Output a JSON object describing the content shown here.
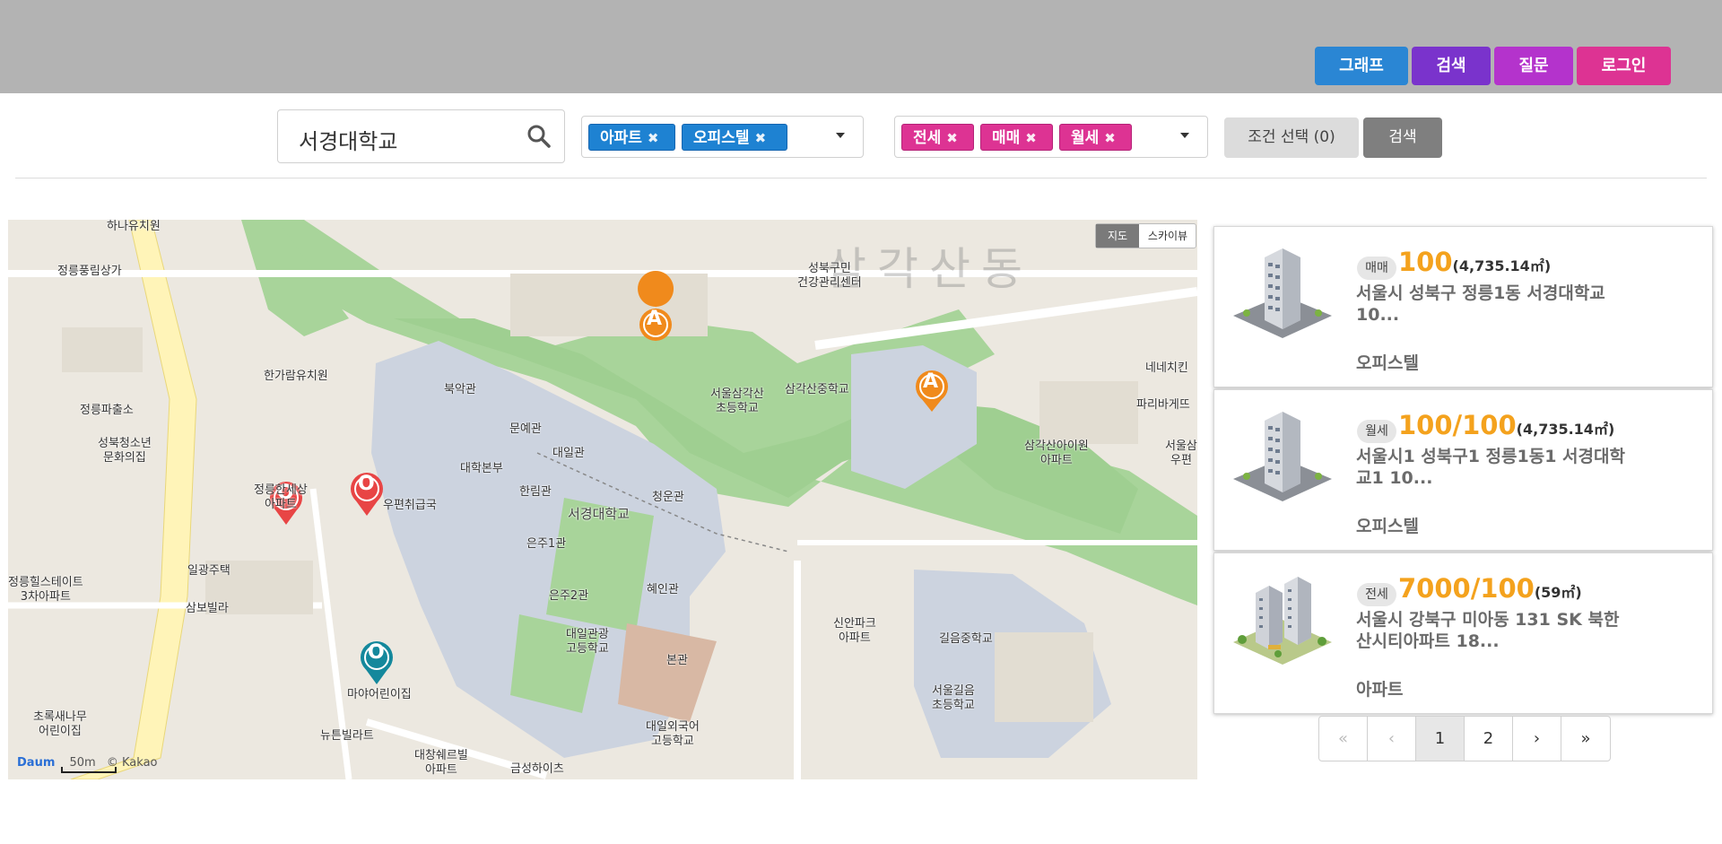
{
  "header": {
    "buttons": {
      "graph": "그래프",
      "search": "검색",
      "question": "질문",
      "login": "로그인"
    }
  },
  "search": {
    "value": "서경대학교",
    "icon": "search-icon"
  },
  "filters": {
    "type_chips": [
      "아파트",
      "오피스텔"
    ],
    "deal_chips": [
      "전세",
      "매매",
      "월세"
    ],
    "chip_remove_glyph": "✖",
    "condition_button": "조건 선택 (0)",
    "search_button": "검색"
  },
  "map": {
    "type_toggle": {
      "map": "지도",
      "skyview": "스카이뷰"
    },
    "dong_label": "삼각산동",
    "scale": "50m",
    "copyright": "© Kakao",
    "logo": "Daum",
    "labels": {
      "jeongneung_plaza": "정릉풍림상가",
      "police": "정릉파출소",
      "youth_center": "성북청소년\n문화의집",
      "hangaram": "한가람유치원",
      "bugak": "북악관",
      "munye": "문예관",
      "daeil": "대일관",
      "bonbu": "대학본부",
      "hallim": "한림관",
      "cheongun": "청운관",
      "skuniv": "서경대학교",
      "eunju1": "은주1관",
      "eunju2": "은주2관",
      "hyein": "혜인관",
      "daeilgwan_hs": "대일관광\n고등학교",
      "bongwan": "본관",
      "daeil_fl_hs": "대일외국어\n고등학교",
      "samgak_elem": "서울삼각산\n초등학교",
      "samgak_middle": "삼각산중학교",
      "health_center": "성북구민\n건강관리센터",
      "samgak_kinder": "삼각산아이원\n아파트",
      "nene": "네네치킨",
      "paris": "파리바게뜨",
      "seoul_post": "서울삼\n우편",
      "shinan": "신안파크\n아파트",
      "gileum_middle": "길음중학교",
      "gileum_elem": "서울길음\n초등학교",
      "post": "우편취급국",
      "jeongneung_apt": "정릉한세상\n아파트",
      "ilgwang": "일광주택",
      "sambo": "삼보빌라",
      "hills": "정릉힐스테이트\n3차아파트",
      "choroksae": "초록새나무\n어린이집",
      "maya": "마야어린이집",
      "newtown": "뉴튼빌라트",
      "daechang": "대창쉐르빌\n아파트",
      "geumseong": "금성하이츠",
      "hanul": "하나유치원"
    },
    "markers": [
      {
        "letter": "A",
        "color": "#f08a1c"
      },
      {
        "letter": "A",
        "color": "#f08a1c"
      },
      {
        "letter": "O",
        "color": "#e84545"
      },
      {
        "letter": "O",
        "color": "#e84545"
      },
      {
        "letter": "O",
        "color": "#14889c"
      }
    ]
  },
  "results": [
    {
      "deal": "매매",
      "price": "100",
      "area": "(4,735.14㎡)",
      "address": "서울시 성북구 정릉1동 서경대학교 10...",
      "ptype": "오피스텔"
    },
    {
      "deal": "월세",
      "price": "100/100",
      "area": "(4,735.14㎡)",
      "address": "서울시1 성북구1 정릉1동1 서경대학교1 10...",
      "ptype": "오피스텔"
    },
    {
      "deal": "전세",
      "price": "7000/100",
      "area": "(59㎡)",
      "address": "서울시 강북구 미아동 131 SK 북한산시티아파트 18...",
      "ptype": "아파트"
    }
  ],
  "pagination": {
    "first": "«",
    "prev": "‹",
    "pages": [
      "1",
      "2"
    ],
    "next": "›",
    "last": "»"
  }
}
